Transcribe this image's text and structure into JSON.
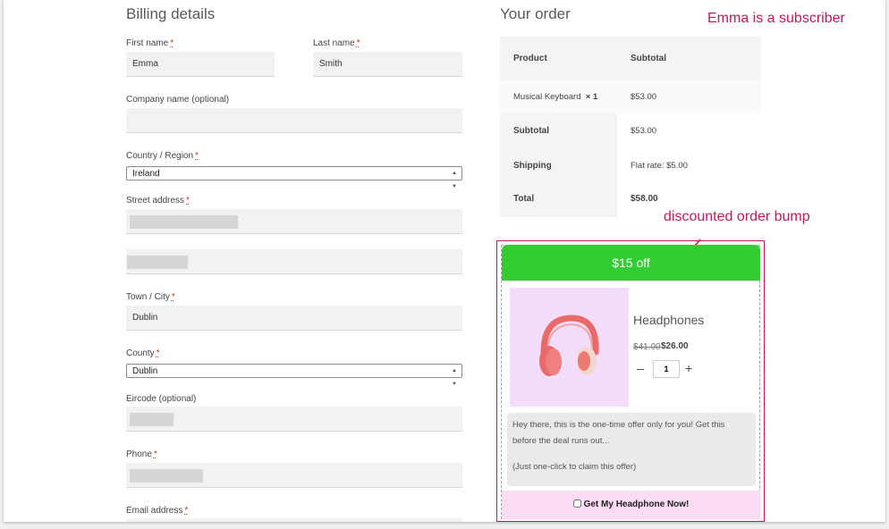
{
  "billing": {
    "title": "Billing details",
    "required_mark": "*",
    "first_name": {
      "label": "First name",
      "value": "Emma"
    },
    "last_name": {
      "label": "Last name",
      "value": "Smith"
    },
    "company": {
      "label": "Company name (optional)",
      "value": ""
    },
    "country": {
      "label": "Country / Region",
      "value": "Ireland"
    },
    "street": {
      "label": "Street address"
    },
    "town": {
      "label": "Town / City",
      "value": "Dublin"
    },
    "county": {
      "label": "County",
      "value": "Dublin"
    },
    "eircode": {
      "label": "Eircode (optional)"
    },
    "phone": {
      "label": "Phone"
    },
    "email": {
      "label": "Email address"
    }
  },
  "order": {
    "title": "Your order",
    "head_product": "Product",
    "head_subtotal": "Subtotal",
    "item_name": "Musical Keyboard",
    "item_qty": "× 1",
    "item_price": "$53.00",
    "subtotal_label": "Subtotal",
    "subtotal_value": "$53.00",
    "shipping_label": "Shipping",
    "shipping_value": "Flat rate: $5.00",
    "total_label": "Total",
    "total_value": "$58.00"
  },
  "annotations": {
    "subscriber_note": "Emma is a subscriber",
    "bump_note": "discounted order bump",
    "color": "#c2185b"
  },
  "bump": {
    "banner": "$15 off",
    "banner_color": "#32cd32",
    "product_name": "Headphones",
    "price_old": "$41.00",
    "price_new": "$26.00",
    "qty_minus": "–",
    "qty_value": "1",
    "qty_plus": "+",
    "offer_line1": "Hey there, this is the one-time offer only for you! Get this before the deal runs out...",
    "offer_line2": "(Just one-click to claim this offer)",
    "claim_label": "Get My Headphone Now!",
    "image_icon": "headphones-icon"
  }
}
